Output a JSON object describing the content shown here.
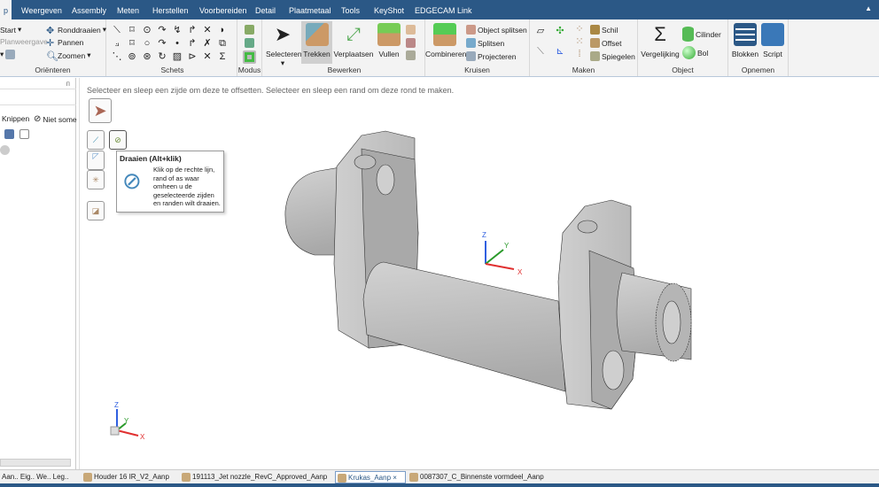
{
  "menu": {
    "tabs": [
      "p",
      "Weergeven",
      "Assembly",
      "Meten",
      "Herstellen",
      "Voorbereiden",
      "Detail",
      "Plaatmetaal",
      "Tools",
      "KeyShot",
      "EDGECAM Link"
    ],
    "active": 0
  },
  "ribbon": {
    "orient": {
      "label": "Oriënteren",
      "start": "Start",
      "plan": "Planweergave",
      "spin": "Ronddraaien",
      "pan": "Pannen",
      "zoom": "Zoomen"
    },
    "sketch": {
      "label": "Schets"
    },
    "mode": {
      "label": "Modus"
    },
    "edit": {
      "label": "Bewerken",
      "select": "Selecteren",
      "pull": "Trekken",
      "move": "Verplaatsen",
      "fill": "Vullen"
    },
    "intersect": {
      "label": "Kruisen",
      "combine": "Combineren",
      "split_body": "Object splitsen",
      "split": "Splitsen",
      "project": "Projecteren"
    },
    "create": {
      "label": "Maken",
      "shell": "Schil",
      "offset": "Offset",
      "mirror": "Spiegelen"
    },
    "body": {
      "label": "Object",
      "equation": "Vergelijking",
      "cylinder": "Cilinder",
      "sphere": "Bol"
    },
    "record": {
      "label": "Opnemen",
      "blocks": "Blokken",
      "script": "Script"
    }
  },
  "left_panel": {
    "clip": "Knippen",
    "not_some": "Niet some",
    "tabs": "Aan.. Eig.. We.. Leg.."
  },
  "viewport": {
    "hint": "Selecteer en sleep een zijde om deze te offsetten. Selecteer en sleep een rand om deze rond te maken.",
    "tooltip": {
      "title": "Draaien (Alt+klik)",
      "body": "Klik op de rechte lijn, rand of as waar omheen u de geselecteerde zijden en randen wilt draaien."
    },
    "axes": {
      "x": "X",
      "y": "Y",
      "z": "Z"
    }
  },
  "documents": [
    {
      "name": "Houder 16 IR_V2_Aanp",
      "active": false
    },
    {
      "name": "191113_Jet nozzle_RevC_Approved_Aanp",
      "active": false
    },
    {
      "name": "Krukas_Aanp",
      "active": true,
      "close": "×"
    },
    {
      "name": "0087307_C_Binnenste vormdeel_Aanp",
      "active": false
    }
  ],
  "colors": {
    "accent": "#2b5886",
    "x_axis": "#e03030",
    "y_axis": "#2a9a2a",
    "z_axis": "#3060e0"
  }
}
